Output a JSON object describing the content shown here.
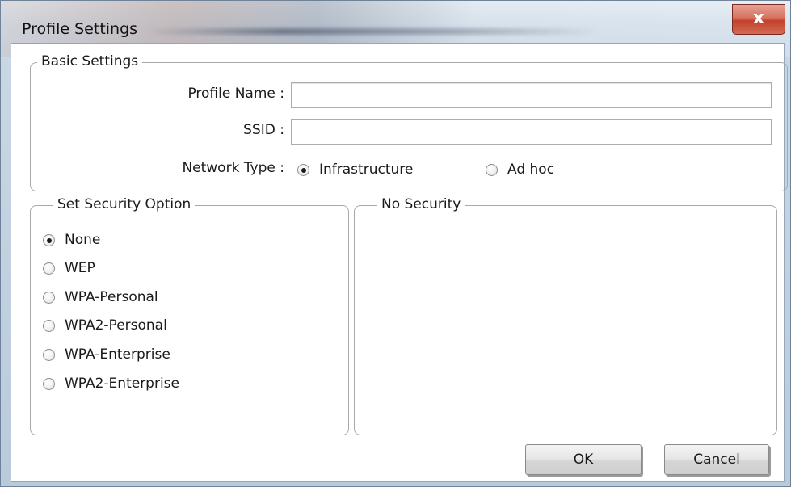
{
  "window": {
    "title": "Profile Settings",
    "close_glyph": "x"
  },
  "basic_settings": {
    "legend": "Basic Settings",
    "profile_name_label": "Profile Name :",
    "profile_name_value": "",
    "ssid_label": "SSID :",
    "ssid_value": "",
    "network_type_label": "Network Type :",
    "network_type_options": [
      {
        "label": "Infrastructure",
        "selected": true
      },
      {
        "label": "Ad hoc",
        "selected": false
      }
    ]
  },
  "security": {
    "legend": "Set Security Option",
    "options": [
      {
        "label": "None",
        "selected": true
      },
      {
        "label": "WEP",
        "selected": false
      },
      {
        "label": "WPA-Personal",
        "selected": false
      },
      {
        "label": "WPA2-Personal",
        "selected": false
      },
      {
        "label": "WPA-Enterprise",
        "selected": false
      },
      {
        "label": "WPA2-Enterprise",
        "selected": false
      }
    ]
  },
  "detail_panel": {
    "legend": "No Security"
  },
  "buttons": {
    "ok_label": "OK",
    "cancel_label": "Cancel"
  }
}
